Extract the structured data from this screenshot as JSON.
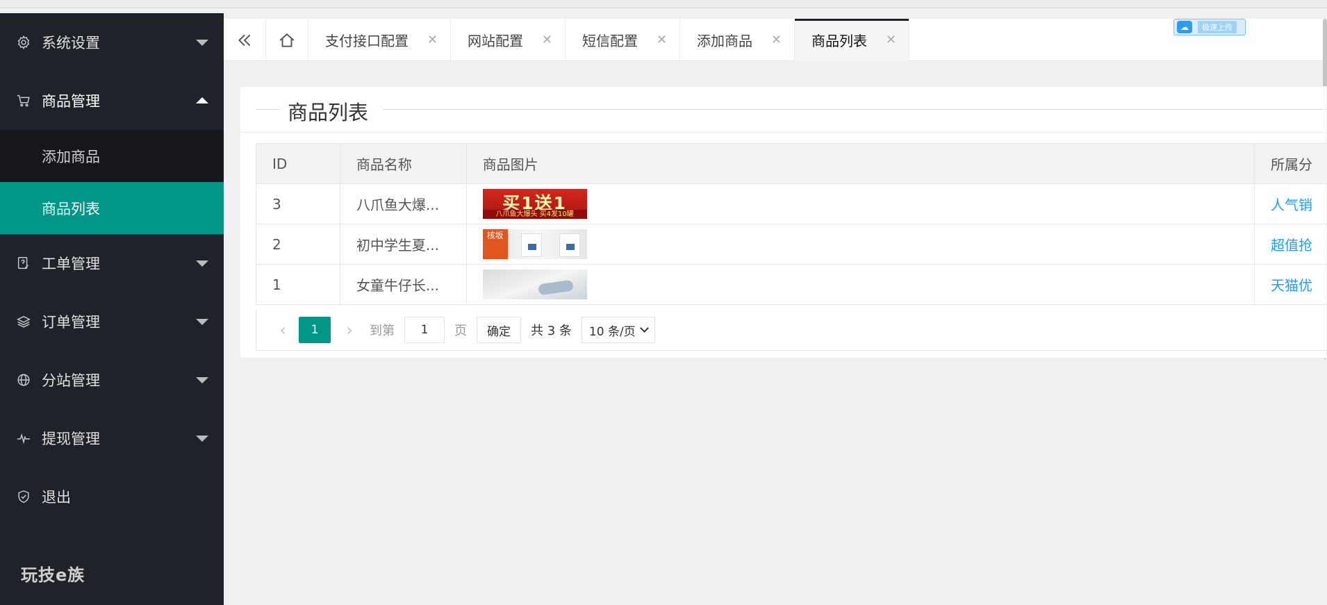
{
  "sidebar": {
    "items": [
      {
        "label": "系统设置",
        "icon": "gear-icon"
      },
      {
        "label": "商品管理",
        "icon": "cart-icon"
      },
      {
        "label": "工单管理",
        "icon": "ticket-icon"
      },
      {
        "label": "订单管理",
        "icon": "layers-icon"
      },
      {
        "label": "分站管理",
        "icon": "globe-icon"
      },
      {
        "label": "提现管理",
        "icon": "pulse-icon"
      },
      {
        "label": "退出",
        "icon": "shield-icon"
      }
    ],
    "submenu": [
      "添加商品",
      "商品列表"
    ],
    "brand": "玩技e族"
  },
  "tabs": [
    {
      "label": "支付接口配置"
    },
    {
      "label": "网站配置"
    },
    {
      "label": "短信配置"
    },
    {
      "label": "添加商品"
    },
    {
      "label": "商品列表"
    }
  ],
  "cloud_badge": {
    "text": "极速上传"
  },
  "card": {
    "title": "商品列表"
  },
  "table": {
    "headers": [
      "ID",
      "商品名称",
      "商品图片",
      "所属分"
    ],
    "rows": [
      {
        "id": "3",
        "name": "八爪鱼大爆...",
        "thumb_big": "买1送1",
        "thumb_small": "八爪鱼大爆头 买4发10罐",
        "category": "人气销"
      },
      {
        "id": "2",
        "name": "初中学生夏...",
        "thumb_tag": "核坂",
        "category": "超值抢"
      },
      {
        "id": "1",
        "name": "女童牛仔长...",
        "category": "天猫优"
      }
    ]
  },
  "pager": {
    "current": "1",
    "goto_label": "到第",
    "page_value": "1",
    "page_unit": "页",
    "confirm": "确定",
    "total": "共 3 条",
    "page_size": "10 条/页"
  },
  "colors": {
    "sidebar_bg": "#20222a",
    "accent": "#009688",
    "link": "#1e9fff"
  }
}
